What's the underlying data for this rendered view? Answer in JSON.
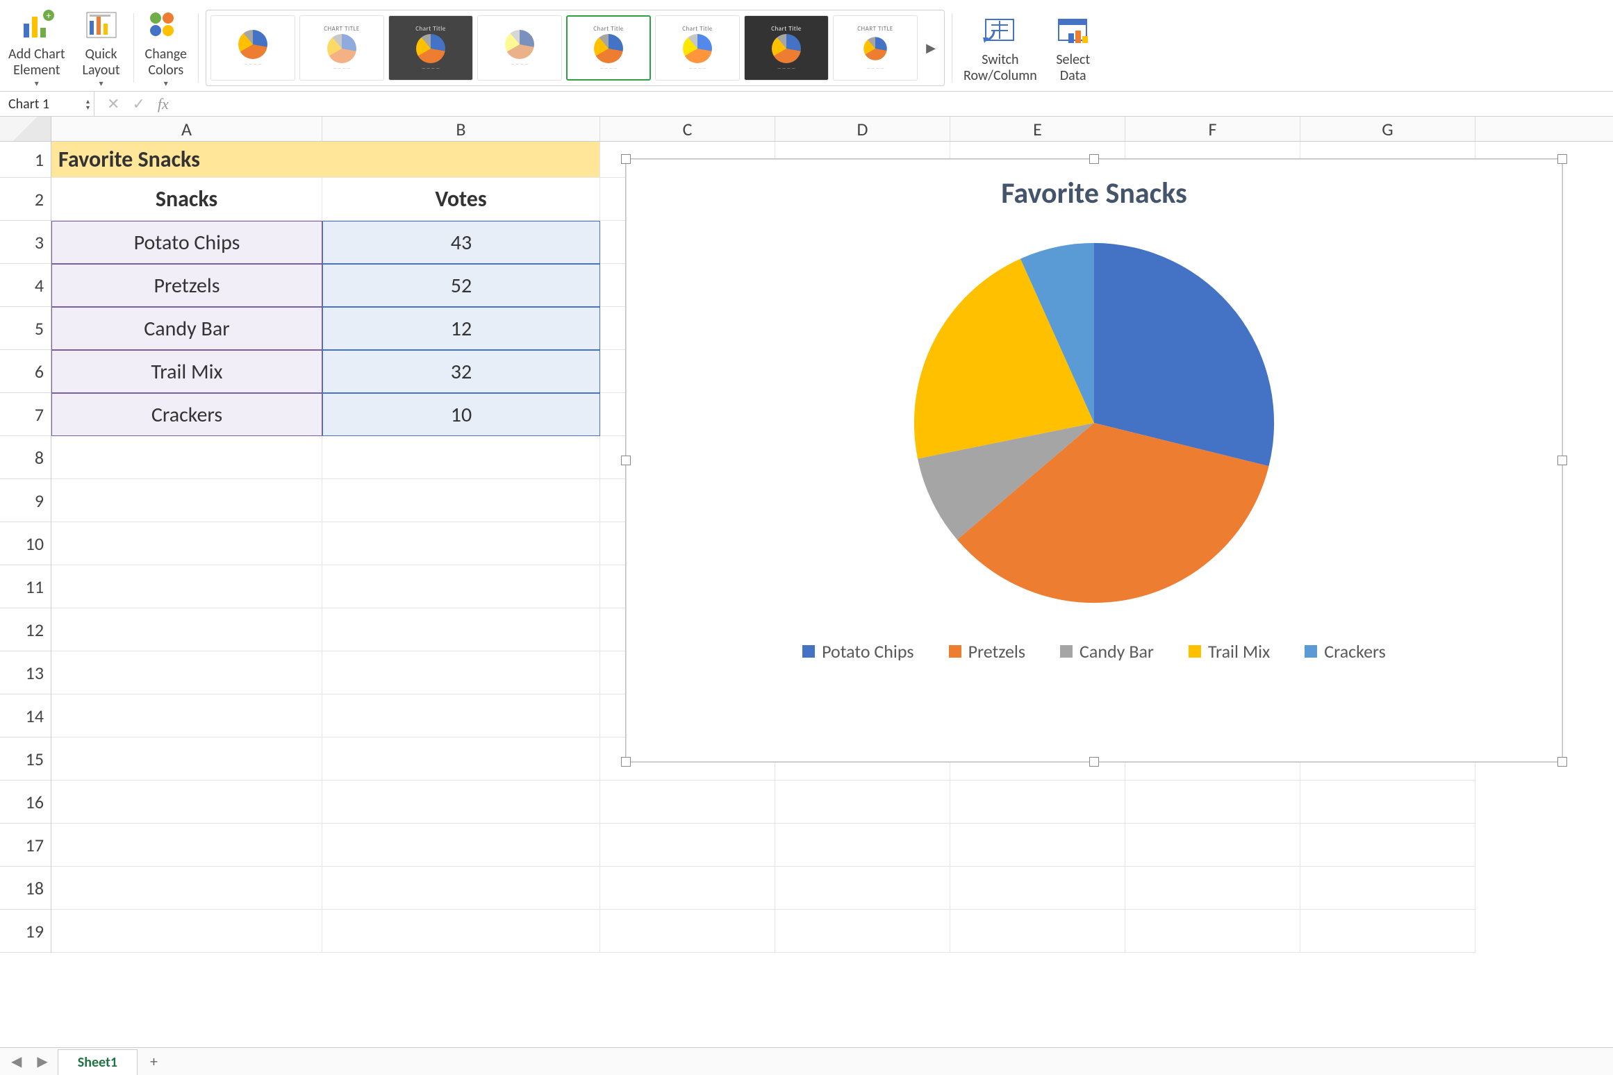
{
  "ribbon": {
    "add_chart_element": "Add Chart\nElement",
    "quick_layout": "Quick\nLayout",
    "change_colors": "Change\nColors",
    "switch_row_col": "Switch\nRow/Column",
    "select_data": "Select\nData",
    "style_labels": [
      "",
      "CHART TITLE",
      "Chart Title",
      "",
      "Chart Title",
      "Chart Title",
      "Chart Title",
      "CHART TITLE"
    ]
  },
  "name_box": "Chart 1",
  "columns": [
    "A",
    "B",
    "C",
    "D",
    "E",
    "F",
    "G"
  ],
  "rows": [
    "1",
    "2",
    "3",
    "4",
    "5",
    "6",
    "7",
    "8",
    "9",
    "10",
    "11",
    "12",
    "13",
    "14",
    "15",
    "16",
    "17",
    "18",
    "19"
  ],
  "cells": {
    "title": "Favorite Snacks",
    "hdr_snacks": "Snacks",
    "hdr_votes": "Votes",
    "items": [
      {
        "snack": "Potato Chips",
        "votes": "43"
      },
      {
        "snack": "Pretzels",
        "votes": "52"
      },
      {
        "snack": "Candy Bar",
        "votes": "12"
      },
      {
        "snack": "Trail Mix",
        "votes": "32"
      },
      {
        "snack": "Crackers",
        "votes": "10"
      }
    ]
  },
  "chart": {
    "title": "Favorite Snacks",
    "legend": [
      "Potato Chips",
      "Pretzels",
      "Candy Bar",
      "Trail Mix",
      "Crackers"
    ],
    "colors": [
      "#4472c4",
      "#ed7d31",
      "#a5a5a5",
      "#ffc000",
      "#5b9bd5"
    ]
  },
  "chart_data": {
    "type": "pie",
    "title": "Favorite Snacks",
    "categories": [
      "Potato Chips",
      "Pretzels",
      "Candy Bar",
      "Trail Mix",
      "Crackers"
    ],
    "values": [
      43,
      52,
      12,
      32,
      10
    ],
    "colors": [
      "#4472c4",
      "#ed7d31",
      "#a5a5a5",
      "#ffc000",
      "#5b9bd5"
    ]
  },
  "sheet_tabs": {
    "active": "Sheet1",
    "add": "+"
  }
}
